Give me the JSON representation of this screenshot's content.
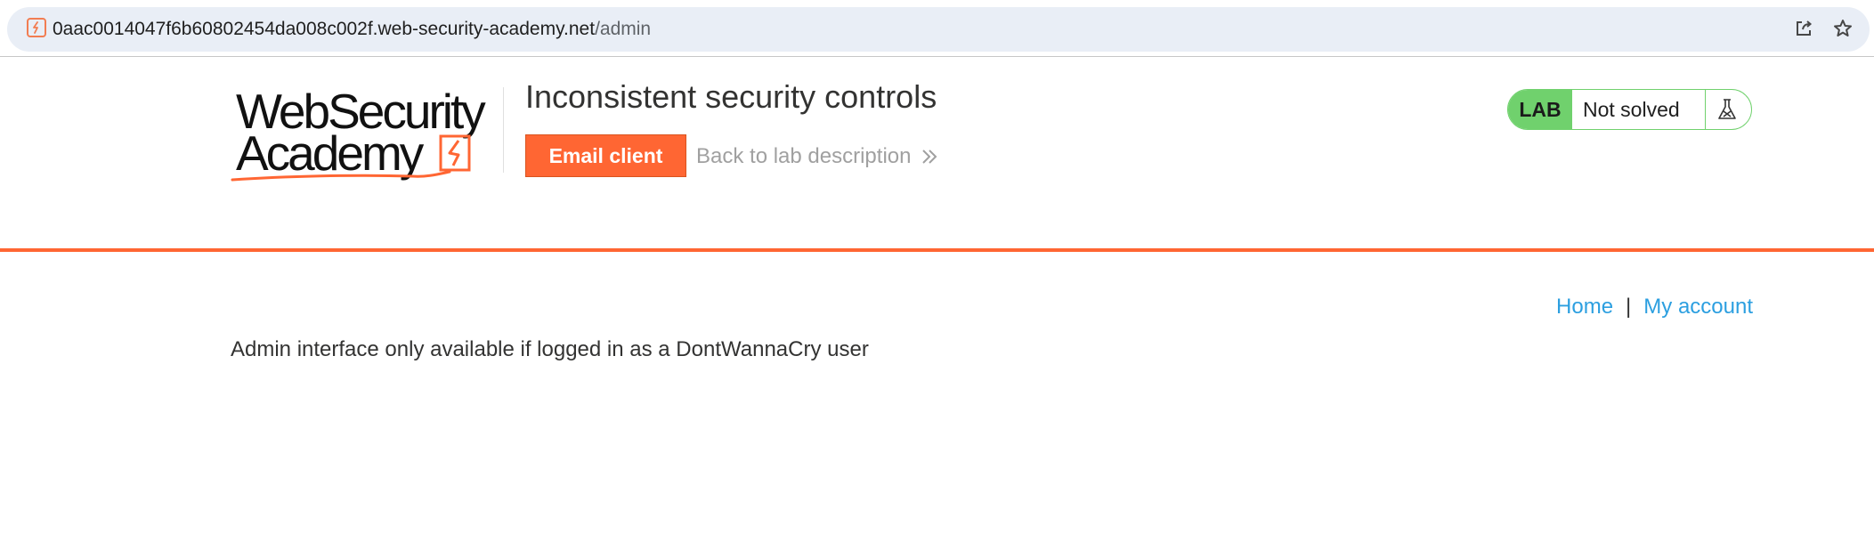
{
  "browser": {
    "url_host": "0aac0014047f6b60802454da008c002f.web-security-academy.net",
    "url_path": "/admin",
    "icons": [
      "site-favicon-icon",
      "share-icon",
      "bookmark-star-icon"
    ]
  },
  "header": {
    "logo_line1": "WebSecurity",
    "logo_line2": "Academy",
    "title": "Inconsistent security controls",
    "email_client_label": "Email client",
    "back_label": "Back to lab description",
    "back_icon": "double-chevron-right-icon"
  },
  "lab_status": {
    "tag": "LAB",
    "status": "Not solved",
    "icon": "flask-icon",
    "color": "#70d16d"
  },
  "nav": {
    "home": "Home",
    "separator": "|",
    "my_account": "My account"
  },
  "main": {
    "message": "Admin interface only available if logged in as a DontWannaCry user"
  },
  "colors": {
    "accent": "#ff6633",
    "link": "#2c9fe0"
  }
}
